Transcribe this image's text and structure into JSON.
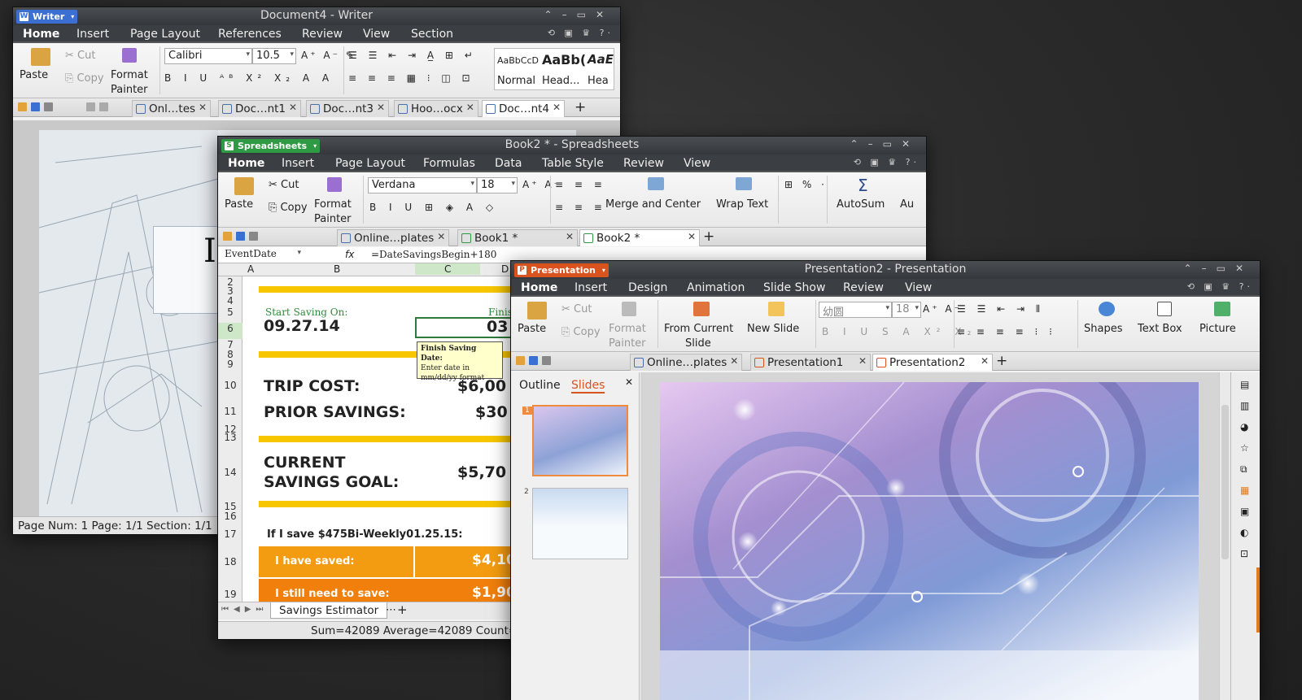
{
  "writer": {
    "app_label": "Writer",
    "title": "Document4 - Writer",
    "menu": [
      "Home",
      "Insert",
      "Page Layout",
      "References",
      "Review",
      "View",
      "Section"
    ],
    "ribbon": {
      "paste": "Paste",
      "cut": "Cut",
      "copy": "Copy",
      "format_painter_1": "Format",
      "format_painter_2": "Painter",
      "font": "Calibri",
      "size": "10.5",
      "style_samples": [
        "AaBbCcD",
        "AaBb(",
        "AaE"
      ],
      "style_names": [
        "Normal",
        "Head...",
        "Hea"
      ]
    },
    "tabs": [
      "Onl…tes",
      "Doc…nt1",
      "Doc…nt3",
      "Hoo…ocx",
      "Doc…nt4"
    ],
    "doc_letter": "I",
    "status": "Page Num: 1  Page: 1/1  Section: 1/1"
  },
  "sheets": {
    "app_label": "Spreadsheets",
    "title": "Book2 * - Spreadsheets",
    "menu": [
      "Home",
      "Insert",
      "Page Layout",
      "Formulas",
      "Data",
      "Table Style",
      "Review",
      "View"
    ],
    "ribbon": {
      "paste": "Paste",
      "cut": "Cut",
      "copy": "Copy",
      "format_painter_1": "Format",
      "format_painter_2": "Painter",
      "font": "Verdana",
      "size": "18",
      "merge": "Merge and Center",
      "wrap": "Wrap Text",
      "autosum": "AutoSum",
      "more": "Au"
    },
    "tabs": [
      "Online…plates",
      "Book1 *",
      "Book2 *"
    ],
    "name_box": "EventDate",
    "fx": "fx",
    "formula": "=DateSavingsBegin+180",
    "col_headers": [
      "A",
      "B",
      "C",
      "D"
    ],
    "row_headers": [
      "2",
      "3",
      "4",
      "5",
      "6",
      "7",
      "8",
      "9",
      "10",
      "11",
      "12",
      "13",
      "14",
      "15",
      "16",
      "17",
      "18",
      "19"
    ],
    "start_label": "Start Saving On:",
    "start_date": "09.27.14",
    "finish_label": "Finis",
    "finish_value": "03",
    "tooltip_title": "Finish Saving Date:",
    "tooltip_body": "Enter date in mm/dd/yy format",
    "trip_cost_label": "TRIP COST:",
    "trip_cost": "$6,00",
    "prior_label": "PRIOR SAVINGS:",
    "prior": "$30",
    "goal_label_1": "CURRENT",
    "goal_label_2": "SAVINGS GOAL:",
    "goal": "$5,70",
    "plan": "If I save $475Bi-Weekly01.25.15:",
    "saved_label": "I have saved:",
    "saved": "$4,10",
    "need_label": "I still need to save:",
    "need": "$1,90",
    "sheet_tab": "Savings Estimator",
    "sheet_more": "⋯",
    "status": "Sum=42089  Average=42089  Count="
  },
  "pres": {
    "app_label": "Presentation",
    "title": "Presentation2 - Presentation",
    "menu": [
      "Home",
      "Insert",
      "Design",
      "Animation",
      "Slide Show",
      "Review",
      "View"
    ],
    "ribbon": {
      "paste": "Paste",
      "cut": "Cut",
      "copy": "Copy",
      "format_painter_1": "Format",
      "format_painter_2": "Painter",
      "from_current_1": "From Current",
      "from_current_2": "Slide",
      "new_slide": "New Slide",
      "font": "幼圆",
      "size": "18",
      "shapes": "Shapes",
      "text_box": "Text Box",
      "picture": "Picture"
    },
    "tabs": [
      "Online…plates",
      "Presentation1",
      "Presentation2"
    ],
    "panel_tabs": [
      "Outline",
      "Slides"
    ],
    "slide_numbers": [
      "1",
      "2"
    ]
  },
  "colors": {
    "writer": "#3b6fd1",
    "sheets": "#2f9a44",
    "pres": "#d9531e",
    "yellow": "#f7c600",
    "orange1": "#f39c12",
    "orange2": "#f07f0b"
  }
}
